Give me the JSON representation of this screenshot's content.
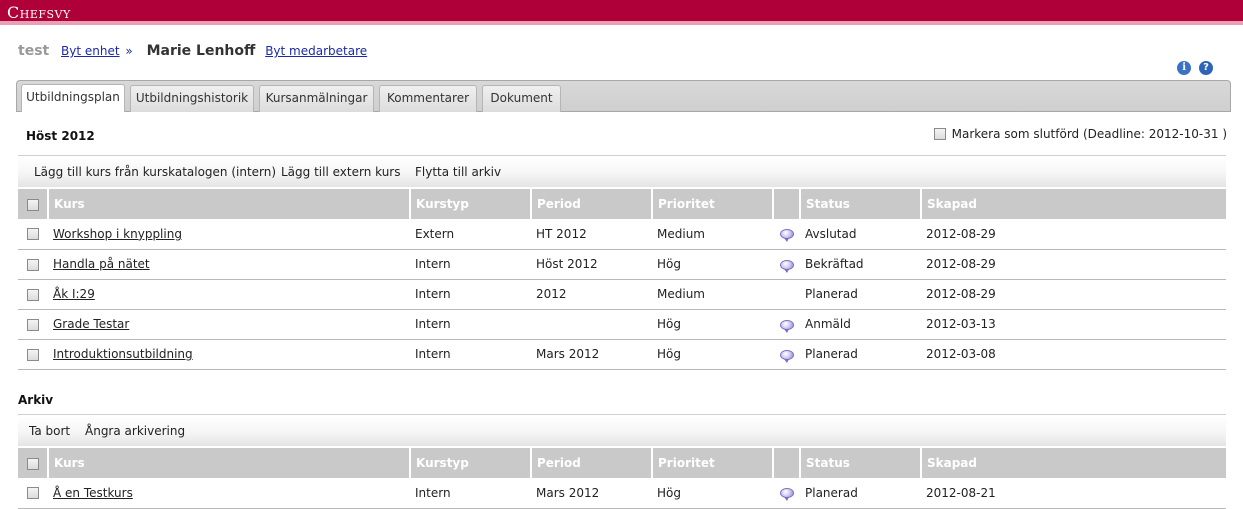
{
  "app": {
    "title": "Chefsvy"
  },
  "breadcrumb": {
    "unit": "test",
    "change_unit_link": "Byt enhet",
    "separator": "»",
    "employee": "Marie Lenhoff",
    "change_employee_link": "Byt medarbetare"
  },
  "help_icons": [
    "info-icon",
    "help-icon"
  ],
  "tabs": [
    {
      "label": "Utbildningsplan",
      "active": true
    },
    {
      "label": "Utbildningshistorik",
      "active": false
    },
    {
      "label": "Kursanmälningar",
      "active": false
    },
    {
      "label": "Kommentarer",
      "active": false
    },
    {
      "label": "Dokument",
      "active": false
    }
  ],
  "plan": {
    "title": "Höst 2012",
    "mark_done_label": "Markera som slutförd (Deadline: 2012-10-31 )",
    "actions": [
      "Lägg till kurs från kurskatalogen (intern)",
      "Lägg till extern kurs",
      "Flytta till arkiv"
    ],
    "columns": [
      "Kurs",
      "Kurstyp",
      "Period",
      "Prioritet",
      "",
      "Status",
      "Skapad"
    ],
    "rows": [
      {
        "course": "Workshop i knyppling",
        "type": "Extern",
        "period": "HT 2012",
        "priority": "Medium",
        "comment": true,
        "status": "Avslutad",
        "created": "2012-08-29"
      },
      {
        "course": "Handla på nätet",
        "type": "Intern",
        "period": "Höst 2012",
        "priority": "Hög",
        "comment": true,
        "status": "Bekräftad",
        "created": "2012-08-29"
      },
      {
        "course": "Åk I:29",
        "type": "Intern",
        "period": "2012",
        "priority": "Medium",
        "comment": false,
        "status": "Planerad",
        "created": "2012-08-29"
      },
      {
        "course": "Grade Testar",
        "type": "Intern",
        "period": "",
        "priority": "Hög",
        "comment": true,
        "status": "Anmäld",
        "created": "2012-03-13"
      },
      {
        "course": "Introduktionsutbildning",
        "type": "Intern",
        "period": "Mars 2012",
        "priority": "Hög",
        "comment": true,
        "status": "Planerad",
        "created": "2012-03-08"
      }
    ]
  },
  "archive": {
    "title": "Arkiv",
    "actions": [
      "Ta bort",
      "Ångra arkivering"
    ],
    "columns": [
      "Kurs",
      "Kurstyp",
      "Period",
      "Prioritet",
      "",
      "Status",
      "Skapad"
    ],
    "rows": [
      {
        "course": "Å en Testkurs",
        "type": "Intern",
        "period": "Mars 2012",
        "priority": "Hög",
        "comment": true,
        "status": "Planerad",
        "created": "2012-08-21"
      }
    ]
  },
  "colors": {
    "brand": "#b0003a",
    "header_gray": "#c9c9c9",
    "link": "#1a2aa8"
  }
}
